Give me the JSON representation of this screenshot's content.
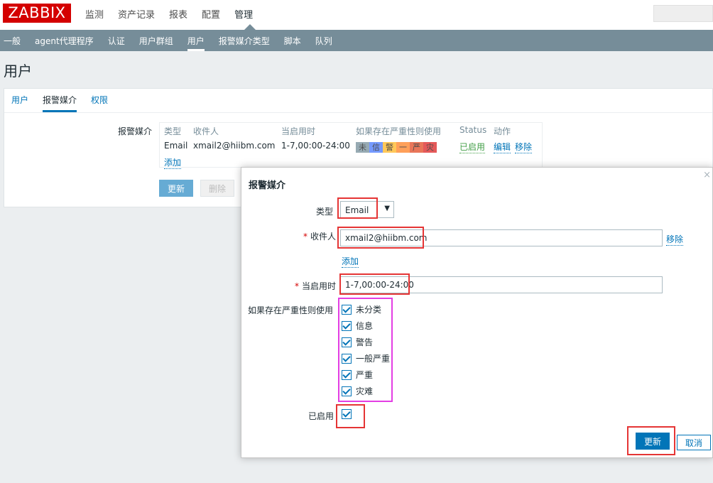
{
  "topbar": {
    "logo": "ZABBIX",
    "nav": [
      "监测",
      "资产记录",
      "报表",
      "配置",
      "管理"
    ]
  },
  "subnav": [
    "一般",
    "agent代理程序",
    "认证",
    "用户群组",
    "用户",
    "报警媒介类型",
    "脚本",
    "队列"
  ],
  "page_title": "用户",
  "tabs": [
    "用户",
    "报警媒介",
    "权限"
  ],
  "media_section": {
    "label": "报警媒介",
    "headers": [
      "类型",
      "收件人",
      "当启用时",
      "如果存在严重性则使用",
      "Status",
      "动作"
    ],
    "row": {
      "type": "Email",
      "recipient": "xmail2@hiibm.com",
      "when_active": "1-7,00:00-24:00",
      "severities": [
        "未",
        "信",
        "警",
        "一",
        "严",
        "灾"
      ],
      "status": "已启用",
      "edit": "编辑",
      "remove": "移除"
    },
    "add": "添加",
    "update_btn": "更新",
    "delete_btn": "删除"
  },
  "colors": {
    "severity": [
      "#97aab3",
      "#7499ff",
      "#ffc859",
      "#ffa059",
      "#e97659",
      "#e45959"
    ],
    "accent": "#0275b8",
    "highlight_red": "#e53535",
    "highlight_magenta": "#e43ee4"
  },
  "dialog": {
    "title": "报警媒介",
    "close": "×",
    "type_label": "类型",
    "type_value": "Email",
    "type_arrow": "▼",
    "required_mark": "*",
    "recipient_label": "收件人",
    "recipient_value": "xmail2@hiibm.com",
    "remove": "移除",
    "add": "添加",
    "when_active_label": "当启用时",
    "when_active_value": "1-7,00:00-24:00",
    "severity_label": "如果存在严重性则使用",
    "severities": [
      "未分类",
      "信息",
      "警告",
      "一般严重",
      "严重",
      "灾难"
    ],
    "enabled_label": "已启用",
    "update_btn": "更新",
    "cancel_btn": "取消"
  }
}
